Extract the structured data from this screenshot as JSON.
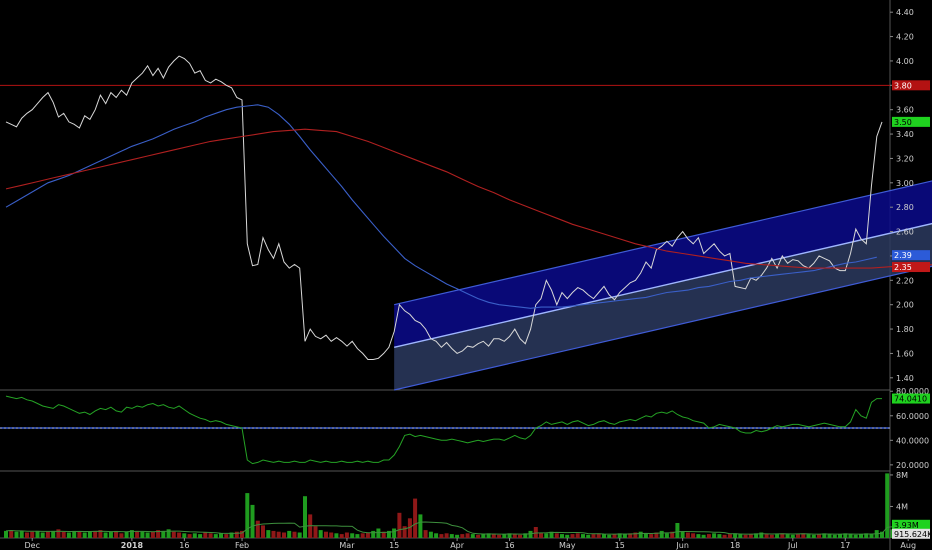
{
  "chart_data": {
    "type": "line",
    "x_ticks": [
      "Dec",
      "2018",
      "16",
      "Feb",
      "Mar",
      "15",
      "Apr",
      "16",
      "May",
      "15",
      "Jun",
      "18",
      "Jul",
      "17",
      "Aug"
    ],
    "x_tick_index": [
      5,
      24,
      34,
      45,
      65,
      74,
      86,
      96,
      107,
      117,
      129,
      139,
      150,
      160,
      172
    ],
    "price_panel": {
      "ylim": [
        1.3,
        4.5
      ],
      "y_ticks": [
        1.4,
        1.6,
        1.8,
        2.0,
        2.2,
        2.4,
        2.6,
        2.8,
        3.0,
        3.2,
        3.4,
        3.6,
        3.8,
        4.0,
        4.2,
        4.4
      ],
      "y_tick_labels": [
        "1.40",
        "1.60",
        "1.80",
        "2.00",
        "2.20",
        "2.40",
        "2.60",
        "2.80",
        "3.00",
        "3.20",
        "3.40",
        "3.60",
        "3.80",
        "4.00",
        "4.20",
        "4.40"
      ],
      "horizontal_line": {
        "value": 3.8,
        "label": "3.80",
        "color": "#b31212"
      },
      "channel": {
        "start_index": 74,
        "end_index": 177,
        "upper": [
          2.0,
          3.02
        ],
        "middle": [
          1.65,
          2.67
        ],
        "lower": [
          1.3,
          2.32
        ],
        "fill_color": "#0a0a8c",
        "line_color": "#3f5bd6"
      },
      "series": [
        {
          "values": [
            3.5,
            3.48,
            3.46,
            3.53,
            3.57,
            3.6,
            3.65,
            3.7,
            3.74,
            3.66,
            3.54,
            3.57,
            3.5,
            3.48,
            3.45,
            3.55,
            3.52,
            3.6,
            3.72,
            3.65,
            3.74,
            3.7,
            3.76,
            3.72,
            3.82,
            3.86,
            3.9,
            3.96,
            3.88,
            3.94,
            3.86,
            3.95,
            4.0,
            4.04,
            4.02,
            3.98,
            3.9,
            3.92,
            3.84,
            3.82,
            3.85,
            3.83,
            3.8,
            3.78,
            3.7,
            3.68,
            2.5,
            2.32,
            2.33,
            2.55,
            2.45,
            2.38,
            2.5,
            2.35,
            2.3,
            2.33,
            2.3,
            1.7,
            1.8,
            1.74,
            1.72,
            1.75,
            1.7,
            1.73,
            1.7,
            1.66,
            1.7,
            1.64,
            1.6,
            1.55,
            1.55,
            1.56,
            1.6,
            1.65,
            1.78,
            2.0,
            1.95,
            1.92,
            1.87,
            1.85,
            1.8,
            1.72,
            1.7,
            1.65,
            1.69,
            1.64,
            1.6,
            1.62,
            1.66,
            1.65,
            1.68,
            1.7,
            1.66,
            1.72,
            1.72,
            1.7,
            1.74,
            1.8,
            1.72,
            1.68,
            1.8,
            2.0,
            2.05,
            2.2,
            2.12,
            2.0,
            2.1,
            2.05,
            2.1,
            2.14,
            2.12,
            2.08,
            2.05,
            2.1,
            2.15,
            2.08,
            2.04,
            2.1,
            2.14,
            2.18,
            2.2,
            2.26,
            2.35,
            2.3,
            2.45,
            2.48,
            2.52,
            2.48,
            2.55,
            2.6,
            2.54,
            2.5,
            2.55,
            2.42,
            2.46,
            2.5,
            2.44,
            2.4,
            2.42,
            2.15,
            2.14,
            2.13,
            2.22,
            2.2,
            2.24,
            2.3,
            2.38,
            2.3,
            2.4,
            2.34,
            2.37,
            2.36,
            2.32,
            2.3,
            2.34,
            2.4,
            2.38,
            2.36,
            2.3,
            2.28,
            2.28,
            2.42,
            2.62,
            2.54,
            2.5,
            2.98,
            3.38,
            3.5
          ],
          "color": "#d8d8d8"
        },
        {
          "values": [
            2.8,
            2.85,
            2.9,
            2.95,
            3.0,
            3.03,
            3.06,
            3.1,
            3.14,
            3.18,
            3.22,
            3.26,
            3.3,
            3.33,
            3.36,
            3.4,
            3.44,
            3.47,
            3.5,
            3.54,
            3.57,
            3.6,
            3.62,
            3.63,
            3.64,
            3.62,
            3.56,
            3.48,
            3.38,
            3.27,
            3.17,
            3.07,
            2.97,
            2.86,
            2.76,
            2.66,
            2.56,
            2.47,
            2.38,
            2.32,
            2.27,
            2.22,
            2.17,
            2.13,
            2.09,
            2.05,
            2.02,
            2.0,
            1.99,
            1.98,
            1.97,
            1.98,
            1.98,
            1.98,
            1.99,
            2.0,
            2.01,
            2.02,
            2.03,
            2.04,
            2.05,
            2.06,
            2.08,
            2.1,
            2.11,
            2.12,
            2.14,
            2.15,
            2.17,
            2.19,
            2.2,
            2.22,
            2.23,
            2.24,
            2.25,
            2.26,
            2.27,
            2.28,
            2.3,
            2.32,
            2.34,
            2.35,
            2.37,
            2.39
          ],
          "start_index": 0,
          "step": 2,
          "color": "#3a5fc8"
        },
        {
          "values": [
            2.95,
            2.98,
            3.01,
            3.04,
            3.07,
            3.1,
            3.13,
            3.16,
            3.19,
            3.22,
            3.25,
            3.28,
            3.31,
            3.34,
            3.36,
            3.38,
            3.4,
            3.42,
            3.43,
            3.44,
            3.43,
            3.42,
            3.38,
            3.34,
            3.29,
            3.24,
            3.19,
            3.14,
            3.09,
            3.03,
            2.97,
            2.92,
            2.86,
            2.81,
            2.76,
            2.71,
            2.66,
            2.62,
            2.58,
            2.54,
            2.5,
            2.47,
            2.44,
            2.42,
            2.4,
            2.38,
            2.36,
            2.34,
            2.33,
            2.32,
            2.31,
            2.3,
            2.3,
            2.3,
            2.3,
            2.3,
            2.31,
            2.32,
            2.32,
            2.33,
            2.34,
            2.35
          ],
          "start_index": 0,
          "step": 3,
          "color": "#b02020"
        }
      ],
      "last_price": {
        "value": 3.5,
        "label": "3.50",
        "color": "#1fd21f"
      },
      "ma_blue_tag": {
        "value": 2.39,
        "label": "2.39",
        "color": "#2c5bd8"
      },
      "ma_red_tag": {
        "value": 2.35,
        "label": "2.35",
        "color": "#c01818"
      }
    },
    "indicator_panel": {
      "ylim": [
        15,
        81
      ],
      "y_ticks": [
        20,
        40,
        60,
        80
      ],
      "y_tick_labels": [
        "20.0000",
        "40.0000",
        "60.0000",
        "80.0000"
      ],
      "line_value": 50,
      "current": {
        "value": 74.041,
        "label": "74.0410",
        "color": "#1fd21f"
      },
      "series": [
        {
          "values": [
            76,
            75,
            74,
            75,
            73,
            72,
            70,
            68,
            67,
            66,
            69,
            68,
            66,
            64,
            62,
            63,
            61,
            64,
            66,
            65,
            67,
            64,
            63,
            67,
            66,
            68,
            67,
            69,
            70,
            68,
            69,
            67,
            66,
            68,
            65,
            62,
            60,
            58,
            57,
            55,
            56,
            55,
            53,
            52,
            51,
            50,
            24,
            21,
            22,
            24,
            23,
            22,
            23,
            22,
            22,
            23,
            22,
            22,
            24,
            23,
            22,
            23,
            22,
            22,
            23,
            22,
            22,
            23,
            22,
            23,
            22,
            22,
            24,
            24,
            28,
            35,
            44,
            45,
            43,
            44,
            43,
            42,
            41,
            40,
            40,
            41,
            40,
            39,
            38,
            39,
            40,
            39,
            40,
            41,
            41,
            40,
            42,
            44,
            42,
            41,
            44,
            50,
            52,
            55,
            53,
            54,
            55,
            53,
            55,
            56,
            54,
            52,
            53,
            55,
            56,
            54,
            53,
            55,
            56,
            57,
            56,
            58,
            60,
            59,
            62,
            63,
            62,
            64,
            61,
            59,
            58,
            56,
            55,
            54,
            50,
            51,
            53,
            52,
            51,
            50,
            47,
            46,
            46,
            48,
            47,
            48,
            50,
            52,
            51,
            52,
            53,
            53,
            52,
            51,
            52,
            53,
            54,
            53,
            52,
            51,
            51,
            55,
            65,
            60,
            58,
            71,
            74,
            74
          ],
          "color": "#25a325"
        }
      ]
    },
    "volume_panel": {
      "ylim": [
        0,
        8.5
      ],
      "y_ticks": [
        8,
        4
      ],
      "y_tick_labels": [
        "8M",
        "4M"
      ],
      "vol_tag": {
        "value": 1.93,
        "label": "3.93M",
        "color": "#1fd21f"
      },
      "avg_tag": {
        "value": 0.915624,
        "label": "915.624K",
        "color": "#e0e0e0"
      },
      "values": [
        0.9,
        1.0,
        0.8,
        0.9,
        0.7,
        0.8,
        0.9,
        0.7,
        0.8,
        0.9,
        1.1,
        0.8,
        0.7,
        0.9,
        0.8,
        0.7,
        0.8,
        0.9,
        1.0,
        0.7,
        0.8,
        0.9,
        0.6,
        0.8,
        1.0,
        0.9,
        0.8,
        0.7,
        0.8,
        1.0,
        0.9,
        1.1,
        0.8,
        0.7,
        0.6,
        0.5,
        0.6,
        0.5,
        0.7,
        0.6,
        0.5,
        0.6,
        0.5,
        0.7,
        0.8,
        0.9,
        5.7,
        4.2,
        2.2,
        1.6,
        1.0,
        0.9,
        0.8,
        0.7,
        0.9,
        0.8,
        0.7,
        5.3,
        3.0,
        1.5,
        1.0,
        0.8,
        0.7,
        0.6,
        0.5,
        0.7,
        0.6,
        0.5,
        0.6,
        0.7,
        0.9,
        1.2,
        0.8,
        0.9,
        1.2,
        3.2,
        1.5,
        2.5,
        5.0,
        3.0,
        1.0,
        0.8,
        0.6,
        0.5,
        0.6,
        0.5,
        0.4,
        0.5,
        0.6,
        0.5,
        0.4,
        0.5,
        0.6,
        0.5,
        0.4,
        0.5,
        0.6,
        0.5,
        0.4,
        0.6,
        0.9,
        1.4,
        0.7,
        0.6,
        0.8,
        0.6,
        0.5,
        0.4,
        0.5,
        0.6,
        0.5,
        0.4,
        0.5,
        0.6,
        0.5,
        0.4,
        0.5,
        0.6,
        0.5,
        0.6,
        0.7,
        0.8,
        0.6,
        0.5,
        0.7,
        0.9,
        0.6,
        0.8,
        1.9,
        0.8,
        0.7,
        0.6,
        0.5,
        0.4,
        0.5,
        0.6,
        0.5,
        0.4,
        0.5,
        0.6,
        0.5,
        0.4,
        0.5,
        0.6,
        0.7,
        0.5,
        0.4,
        0.5,
        0.6,
        0.5,
        0.4,
        0.5,
        0.6,
        0.5,
        0.4,
        0.5,
        0.6,
        0.5,
        0.4,
        0.5,
        0.6,
        0.5,
        0.4,
        0.5,
        0.6,
        0.5,
        1.0,
        0.8,
        8.2,
        1.1,
        1.9
      ],
      "direction": "uduudduududduuduudduudduuduudduudduduudduududduudduddduduudduddudduudduuduudddduduudduudduduudduudduudduuduudduudduuduudduudduuduudduuduudduudduudduduudduudu",
      "up_color": "#1f9c1f",
      "down_color": "#8f1818",
      "avg_color": "#3d8f3d"
    }
  }
}
